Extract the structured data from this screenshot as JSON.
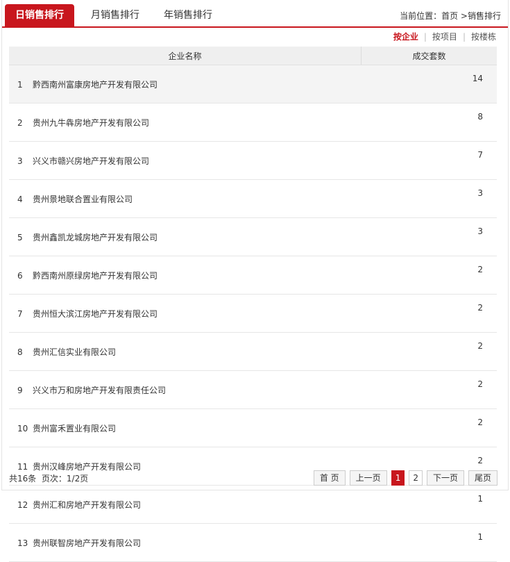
{
  "tabs": [
    {
      "label": "日销售排行",
      "active": true
    },
    {
      "label": "月销售排行",
      "active": false
    },
    {
      "label": "年销售排行",
      "active": false
    }
  ],
  "breadcrumb": {
    "prefix": "当前位置：",
    "home": "首页",
    "separator": " >",
    "current": "销售排行"
  },
  "filters": [
    {
      "label": "按企业",
      "active": true
    },
    {
      "label": "按项目",
      "active": false
    },
    {
      "label": "按楼栋",
      "active": false
    }
  ],
  "filter_separator": "|",
  "table": {
    "headers": [
      "企业名称",
      "成交套数"
    ],
    "rows": [
      {
        "rank": "1",
        "name": "黔西南州富康房地产开发有限公司",
        "count": "14"
      },
      {
        "rank": "2",
        "name": "贵州九牛犇房地产开发有限公司",
        "count": "8"
      },
      {
        "rank": "3",
        "name": "兴义市赣兴房地产开发有限公司",
        "count": "7"
      },
      {
        "rank": "4",
        "name": "贵州景地联合置业有限公司",
        "count": "3"
      },
      {
        "rank": "5",
        "name": "贵州鑫凯龙城房地产开发有限公司",
        "count": "3"
      },
      {
        "rank": "6",
        "name": "黔西南州原绿房地产开发有限公司",
        "count": "2"
      },
      {
        "rank": "7",
        "name": "贵州恒大滨江房地产开发有限公司",
        "count": "2"
      },
      {
        "rank": "8",
        "name": "贵州汇信实业有限公司",
        "count": "2"
      },
      {
        "rank": "9",
        "name": "兴义市万和房地产开发有限责任公司",
        "count": "2"
      },
      {
        "rank": "10",
        "name": "贵州富禾置业有限公司",
        "count": "2"
      },
      {
        "rank": "11",
        "name": "贵州汉峰房地产开发有限公司",
        "count": "2"
      },
      {
        "rank": "12",
        "name": "贵州汇和房地产开发有限公司",
        "count": "1"
      },
      {
        "rank": "13",
        "name": "贵州联智房地产开发有限公司",
        "count": "1"
      }
    ]
  },
  "summary": {
    "total": "共16条",
    "pages": "页次：1/2页"
  },
  "pager": {
    "first": "首 页",
    "prev": "上一页",
    "pages": [
      "1",
      "2"
    ],
    "current": "1",
    "next": "下一页",
    "last": "尾页"
  },
  "colors": {
    "accent": "#c8161d",
    "header_bg": "#efefef"
  }
}
